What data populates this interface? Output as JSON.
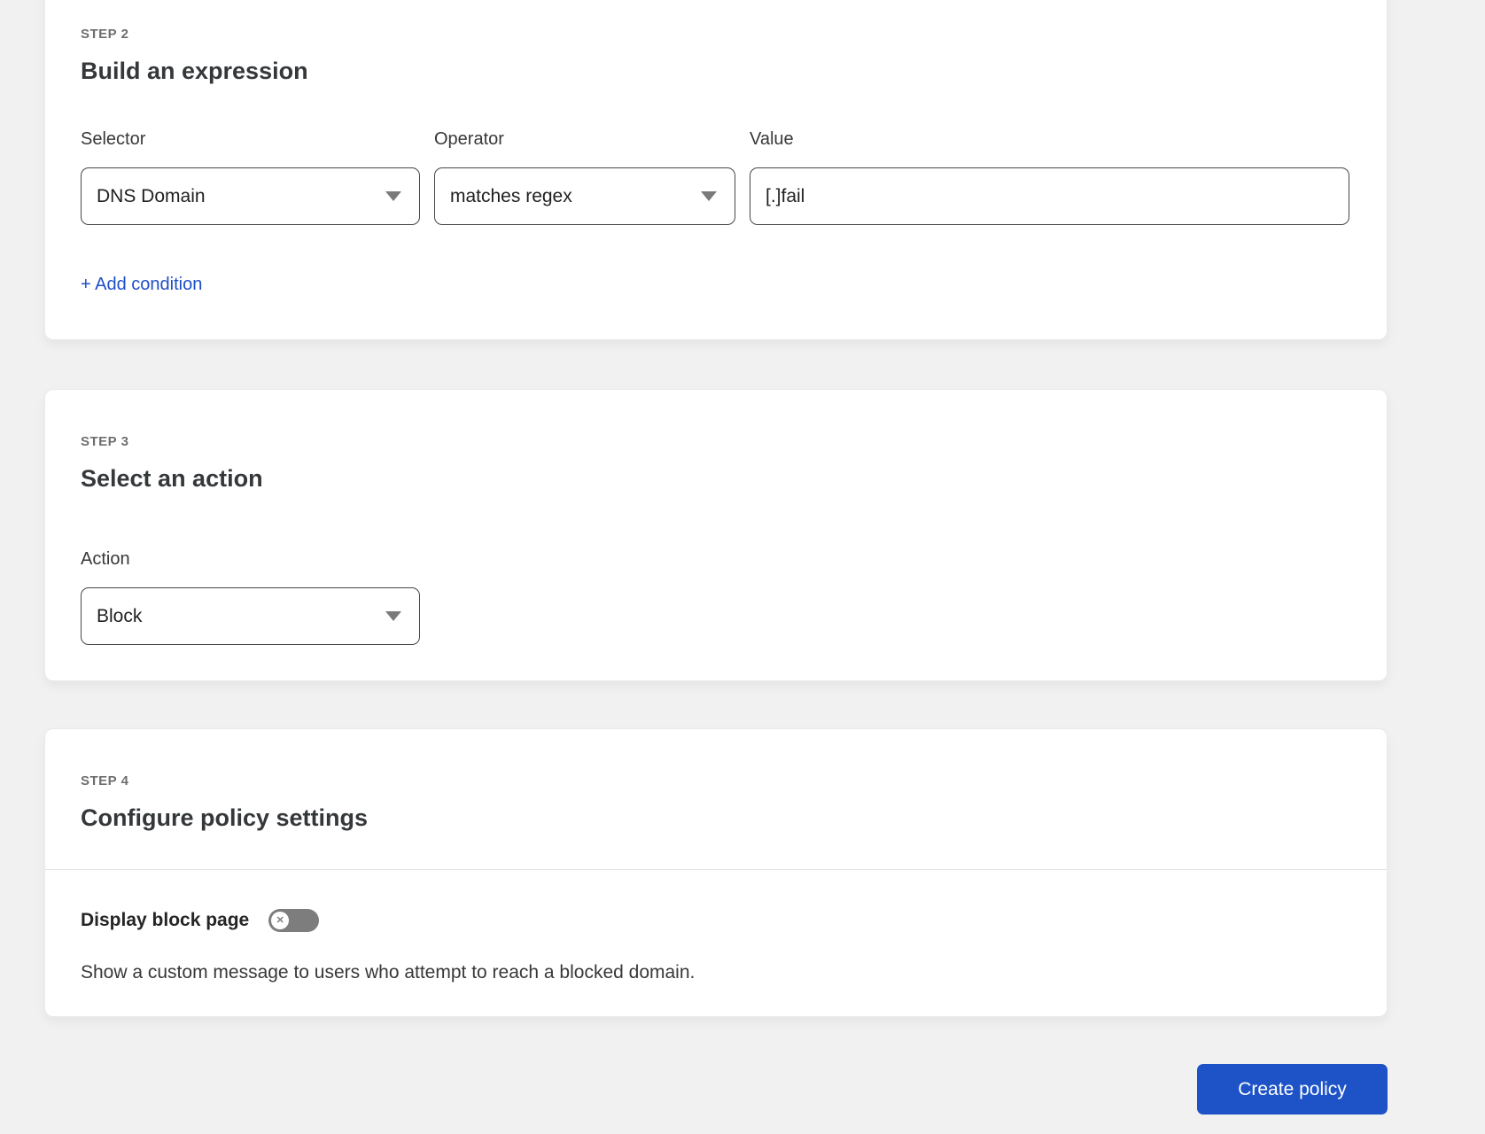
{
  "colors": {
    "background": "#f1f1f1",
    "card": "#ffffff",
    "accent_blue": "#1d53c7",
    "link_blue": "#1d4ec8",
    "toggle_off_gray": "#7d7d7d"
  },
  "icons": {
    "chevron_down": "caret-down-triangle",
    "toggle_off": "✕"
  },
  "step2": {
    "step_label": "STEP 2",
    "title": "Build an expression",
    "selector": {
      "label": "Selector",
      "value": "DNS Domain"
    },
    "operator": {
      "label": "Operator",
      "value": "matches regex"
    },
    "value": {
      "label": "Value",
      "value": "[.]fail"
    },
    "add_condition": "+ Add condition"
  },
  "step3": {
    "step_label": "STEP 3",
    "title": "Select an action",
    "action": {
      "label": "Action",
      "value": "Block"
    }
  },
  "step4": {
    "step_label": "STEP 4",
    "title": "Configure policy settings",
    "display_block_page": {
      "label": "Display block page",
      "state": "off",
      "description": "Show a custom message to users who attempt to reach a blocked domain."
    }
  },
  "footer": {
    "create_policy": "Create policy"
  }
}
